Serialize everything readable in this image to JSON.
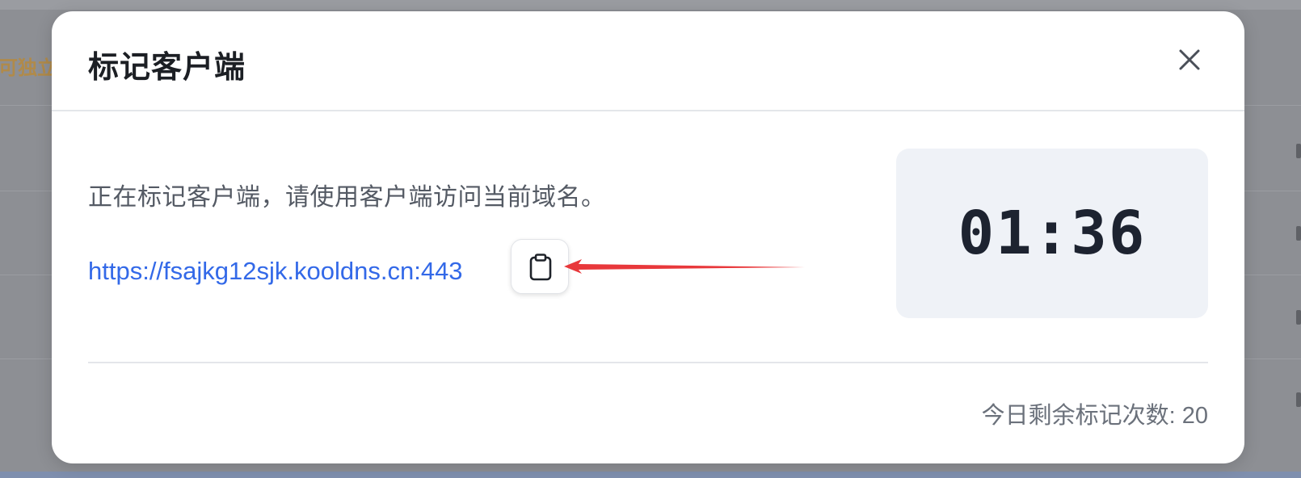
{
  "background": {
    "partial_left_text": "可独立"
  },
  "dialog": {
    "title": "标记客户端",
    "close_icon": "close-icon",
    "description": "正在标记客户端，请使用客户端访问当前域名。",
    "url": "https://fsajkg12sjk.kooldns.cn:443",
    "copy_icon": "clipboard-icon",
    "countdown": "01:36",
    "remaining_label": "今日剩余标记次数: 20"
  },
  "colors": {
    "link": "#3369e8",
    "annotation_arrow": "#e8383b",
    "timer_bg": "#eff2f7",
    "title_text": "#1c1f24"
  }
}
